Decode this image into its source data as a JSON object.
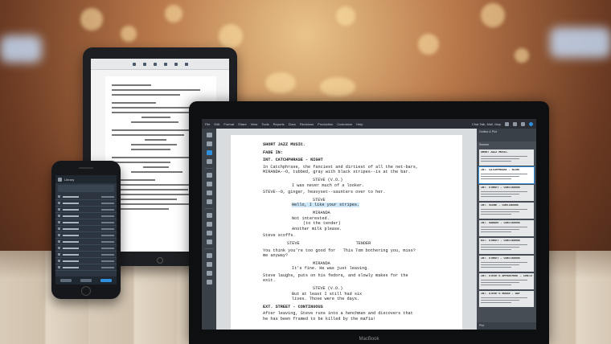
{
  "laptop": {
    "brand": "MacBook",
    "menu": [
      "File",
      "Edit",
      "Format",
      "Share",
      "View",
      "Tools",
      "Reports",
      "Docs",
      "Revisions",
      "Production",
      "Customize",
      "Help"
    ],
    "user_label": "Chat Talk, Mail, Map",
    "script": [
      {
        "type": "scene",
        "text": "SHORT JAZZ MUSIC."
      },
      {
        "type": "scene",
        "text": "FADE IN:"
      },
      {
        "type": "scene",
        "text": "INT. CATCHPHRASE - NIGHT"
      },
      {
        "type": "action",
        "text": "In Catchphrase, the fanciest and dirtiest of all the net-bars,\nMIRANDA--O, tubbed, gray with black stripes--is at the bar."
      },
      {
        "type": "character",
        "text": "STEVE (V.O.)"
      },
      {
        "type": "dialogue",
        "text": "I was never much of a looker."
      },
      {
        "type": "action",
        "text": "STEVE--O, ginger, heavyset--saunters over to her."
      },
      {
        "type": "character",
        "text": "STEVE"
      },
      {
        "type": "dialogue",
        "text": "Hello, I like your stripes.",
        "highlight": true
      },
      {
        "type": "character",
        "text": "MIRANDA"
      },
      {
        "type": "dialogue",
        "text": "Not interested."
      },
      {
        "type": "parenthetical",
        "text": "(to the tender)"
      },
      {
        "type": "dialogue",
        "text": "Another milk please."
      },
      {
        "type": "action",
        "text": "Steve scoffs."
      },
      {
        "type": "dual",
        "left": "STEVE",
        "right": "TENDER"
      },
      {
        "type": "action",
        "text": "You think you're too good for   This Tom bothering you, miss?\nme anyway?"
      },
      {
        "type": "character",
        "text": "MIRANDA"
      },
      {
        "type": "dialogue",
        "text": "It's fine. He was just leaving."
      },
      {
        "type": "action",
        "text": "Steve laughs, puts on his fedora, and slowly makes for the\nexit."
      },
      {
        "type": "character",
        "text": "STEVE (V.O.)"
      },
      {
        "type": "dialogue",
        "text": "But at least I still had six\nlives. Those were the days."
      },
      {
        "type": "scene",
        "text": "EXT. STREET - CONTINUOUS"
      },
      {
        "type": "action",
        "text": "After leaving, Steve runs into a henchman and discovers that\nhe has been framed to be killed by the mafia!"
      }
    ],
    "panel": {
      "header": "Outline & Plot",
      "section": "Scenes",
      "footer": "Plot",
      "cards": [
        {
          "title": "SHORT JAZZ MUSIC."
        },
        {
          "title": "INT. CATCHPHRASE - NIGHT",
          "selected": true
        },
        {
          "title": "INT. STREET - CONTINUOUS"
        },
        {
          "title": "INT. SCENE - CONTINUOUS"
        },
        {
          "title": "INT. GARAGE - CONTINUOUS"
        },
        {
          "title": "EXT. STREET - CONTINUOUS"
        },
        {
          "title": "INT. STREET - CONTINUOUS"
        },
        {
          "title": "INT. STEVE'S APPARTMENT - CONTINUOUS"
        },
        {
          "title": "INT. STEVE'S HOUSE - DAY"
        }
      ]
    }
  },
  "phone": {
    "title": "Library"
  }
}
